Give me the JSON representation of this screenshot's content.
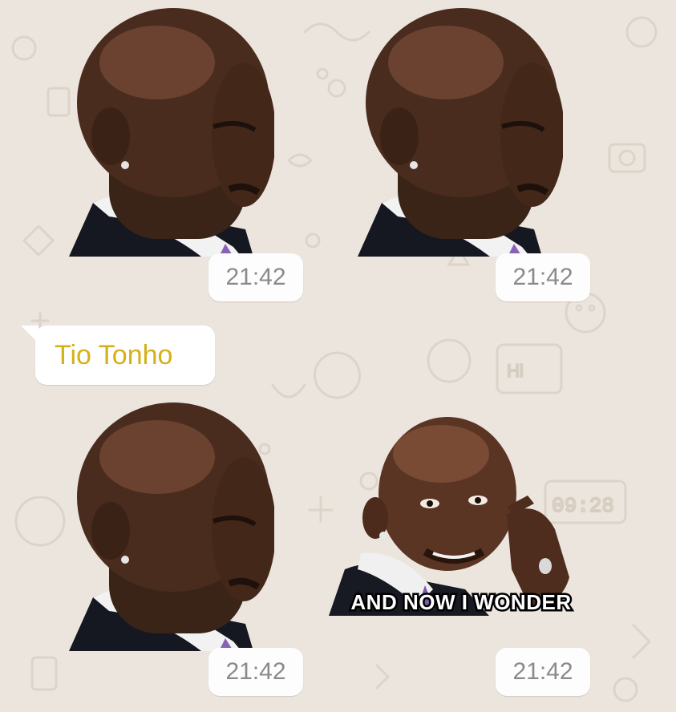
{
  "chat": {
    "sender_name": "Tio Tonho",
    "name_color": "#d4b019",
    "background": "#ece5dd",
    "messages": [
      {
        "type": "sticker",
        "sticker": "squinting-man-sticker",
        "time": "21:42"
      },
      {
        "type": "sticker",
        "sticker": "squinting-man-sticker",
        "time": "21:42"
      },
      {
        "type": "sticker",
        "sticker": "squinting-man-sticker",
        "time": "21:42"
      },
      {
        "type": "sticker",
        "sticker": "and-now-i-wonder-sticker",
        "caption": "AND NOW I WONDER",
        "time": "21:42"
      }
    ]
  }
}
